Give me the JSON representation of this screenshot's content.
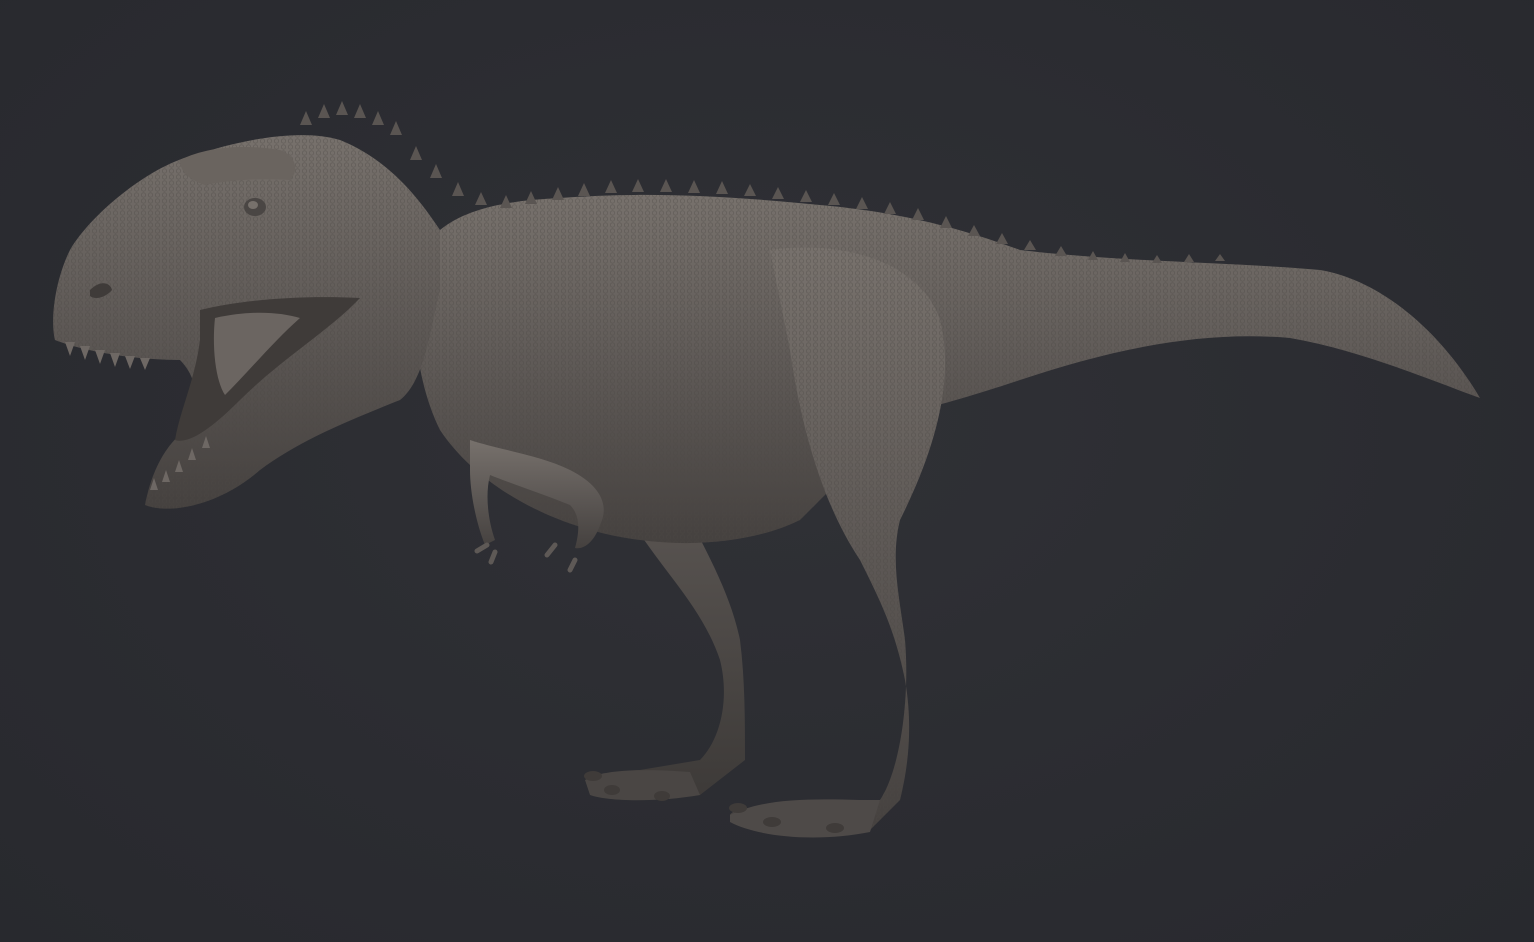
{
  "scene": {
    "background_color": "#2b2c31",
    "clay_color": "#5e5956",
    "clay_highlight": "#7d7772",
    "clay_shadow": "#3f3b39",
    "subject": "tyrannosaurus-sculpt"
  }
}
